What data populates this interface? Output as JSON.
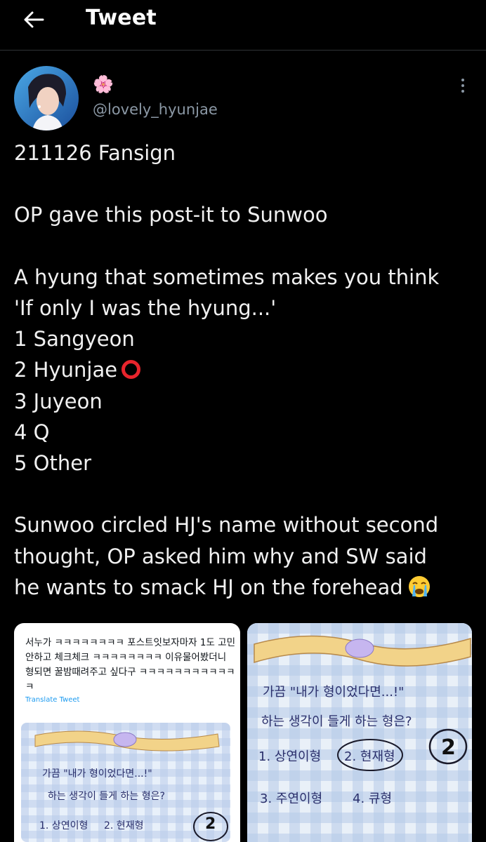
{
  "header": {
    "title": "Tweet"
  },
  "author": {
    "display_name": "🌸",
    "handle": "@lovely_hyunjae"
  },
  "tweet": {
    "line1": "211126 Fansign",
    "line2": "OP gave this post-it to Sunwoo",
    "question_line1": "A hyung that sometimes makes you think",
    "question_line2": "'If only I was the hyung...'",
    "opt1": "1 Sangyeon",
    "opt2": "2 Hyunjae",
    "opt3": "3 Juyeon",
    "opt4": "4 Q",
    "opt5": "5 Other",
    "closing_line1": "Sunwoo circled HJ's name without second",
    "closing_line2": "thought, OP asked him why and SW said",
    "closing_line3": "he wants to smack HJ on the forehead"
  },
  "media": {
    "embedded_tweet_text": "서누가 ㅋㅋㅋㅋㅋㅋㅋㅋ 포스트잇보자마자 1도 고민안하고 체크체크 ㅋㅋㅋㅋㅋㅋㅋㅋ 이유물어봤더니 형되면 꿀밤때려주고 싶다구 ㅋㅋㅋㅋㅋㅋㅋㅋㅋㅋㅋㅋ",
    "translate_label": "Translate Tweet",
    "note": {
      "line1": "가끔 \"내가 형이었다면...!\"",
      "line2": "하는 생각이 들게 하는 형은?",
      "opt1": "1. 상연이형",
      "opt2": "2. 현재형",
      "opt3": "3. 주연이형",
      "opt4": "4. 큐형",
      "circled_number": "2"
    }
  },
  "colors": {
    "background": "#000000",
    "text": "#e7e9ea",
    "secondary": "#8b98a5",
    "link": "#1d9bf0",
    "circle_emoji": "#e8242c"
  }
}
